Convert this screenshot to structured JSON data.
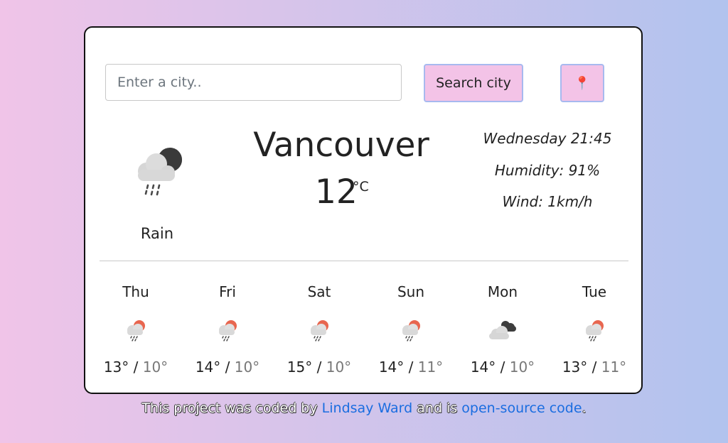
{
  "search": {
    "placeholder": "Enter a city..",
    "button_label": "Search city",
    "location_icon": "pin-icon"
  },
  "current": {
    "city": "Vancouver",
    "temperature": "12",
    "unit": "°C",
    "description": "Rain",
    "icon": "rain-night-icon",
    "datetime": "Wednesday 21:45",
    "humidity": "Humidity: 91%",
    "wind": "Wind: 1km/h"
  },
  "forecast": [
    {
      "day": "Thu",
      "high": "13°",
      "sep": "/",
      "low": "10°",
      "icon": "rain-sun-icon"
    },
    {
      "day": "Fri",
      "high": "14°",
      "sep": "/",
      "low": "10°",
      "icon": "rain-sun-icon"
    },
    {
      "day": "Sat",
      "high": "15°",
      "sep": "/",
      "low": "10°",
      "icon": "rain-sun-icon"
    },
    {
      "day": "Sun",
      "high": "14°",
      "sep": "/",
      "low": "11°",
      "icon": "rain-sun-icon"
    },
    {
      "day": "Mon",
      "high": "14°",
      "sep": "/",
      "low": "10°",
      "icon": "clouds-icon"
    },
    {
      "day": "Tue",
      "high": "13°",
      "sep": "/",
      "low": "11°",
      "icon": "rain-sun-icon"
    }
  ],
  "footer": {
    "prefix": "This project was coded by",
    "author_link": "Lindsay Ward",
    "middle": "and is",
    "source_link": "open-source code",
    "suffix": "."
  },
  "colors": {
    "button_bg": "#f3c3e7",
    "button_border": "#a7b9ef",
    "link": "#1a6de0",
    "sun": "#e8664f"
  }
}
